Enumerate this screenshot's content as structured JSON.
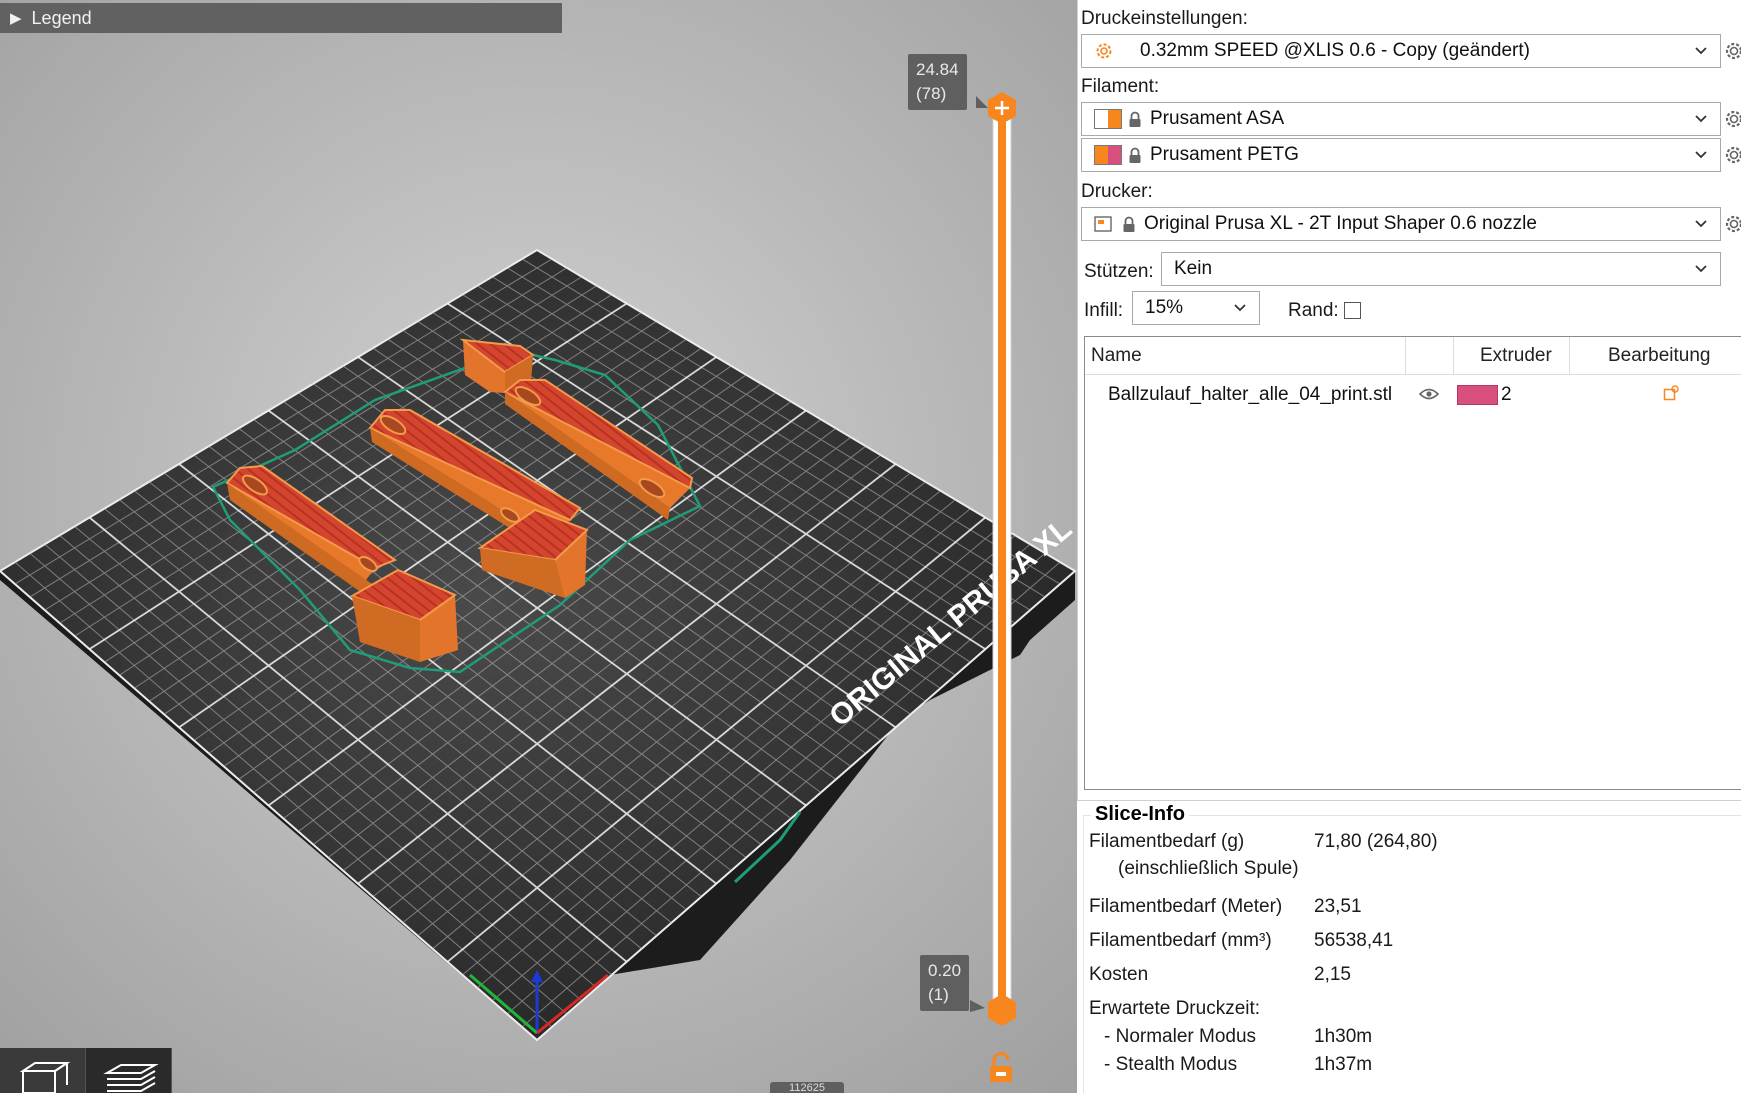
{
  "legend": {
    "label": "Legend"
  },
  "slider": {
    "top": {
      "height": "24.84",
      "layer": "(78)"
    },
    "bottom": {
      "height": "0.20",
      "layer": "(1)"
    }
  },
  "bed": {
    "brand_text": "ORIGINAL PRUSA XL"
  },
  "bottom_counter": "112625",
  "settings": {
    "print_label": "Druckeinstellungen:",
    "print_value": "0.32mm SPEED @XLIS 0.6 - Copy (geändert)",
    "filament_label": "Filament:",
    "filaments": [
      {
        "name": "Prusament ASA",
        "color_a": "#ffffff",
        "color_b": "#f7861e"
      },
      {
        "name": "Prusament PETG",
        "color_a": "#f7861e",
        "color_b": "#d9507e"
      }
    ],
    "printer_label": "Drucker:",
    "printer_value": "Original Prusa XL - 2T Input Shaper 0.6 nozzle",
    "supports_label": "Stützen:",
    "supports_value": "Kein",
    "infill_label": "Infill:",
    "infill_value": "15%",
    "brim_label": "Rand:"
  },
  "objects": {
    "col_name": "Name",
    "col_extruder": "Extruder",
    "col_edit": "Bearbeitung",
    "rows": [
      {
        "name": "Ballzulauf_halter_alle_04_print.stl",
        "extruder": "2",
        "extruder_color": "#d9507e"
      }
    ]
  },
  "slice_info": {
    "title": "Slice-Info",
    "filament_g_label": "Filamentbedarf (g)",
    "filament_g_sub": "(einschließlich Spule)",
    "filament_g_value": "71,80 (264,80)",
    "filament_m_label": "Filamentbedarf (Meter)",
    "filament_m_value": "23,51",
    "filament_mm3_label": "Filamentbedarf (mm³)",
    "filament_mm3_value": "56538,41",
    "cost_label": "Kosten",
    "cost_value": "2,15",
    "time_label": "Erwartete Druckzeit:",
    "normal_label": "- Normaler Modus",
    "normal_value": "1h30m",
    "stealth_label": "- Stealth Modus",
    "stealth_value": "1h37m"
  },
  "colors": {
    "accent": "#f7861e",
    "part_orange": "#e8792a",
    "part_red": "#d2442f",
    "bed": "#2f2f2f",
    "skirt": "#1f9d7a"
  }
}
